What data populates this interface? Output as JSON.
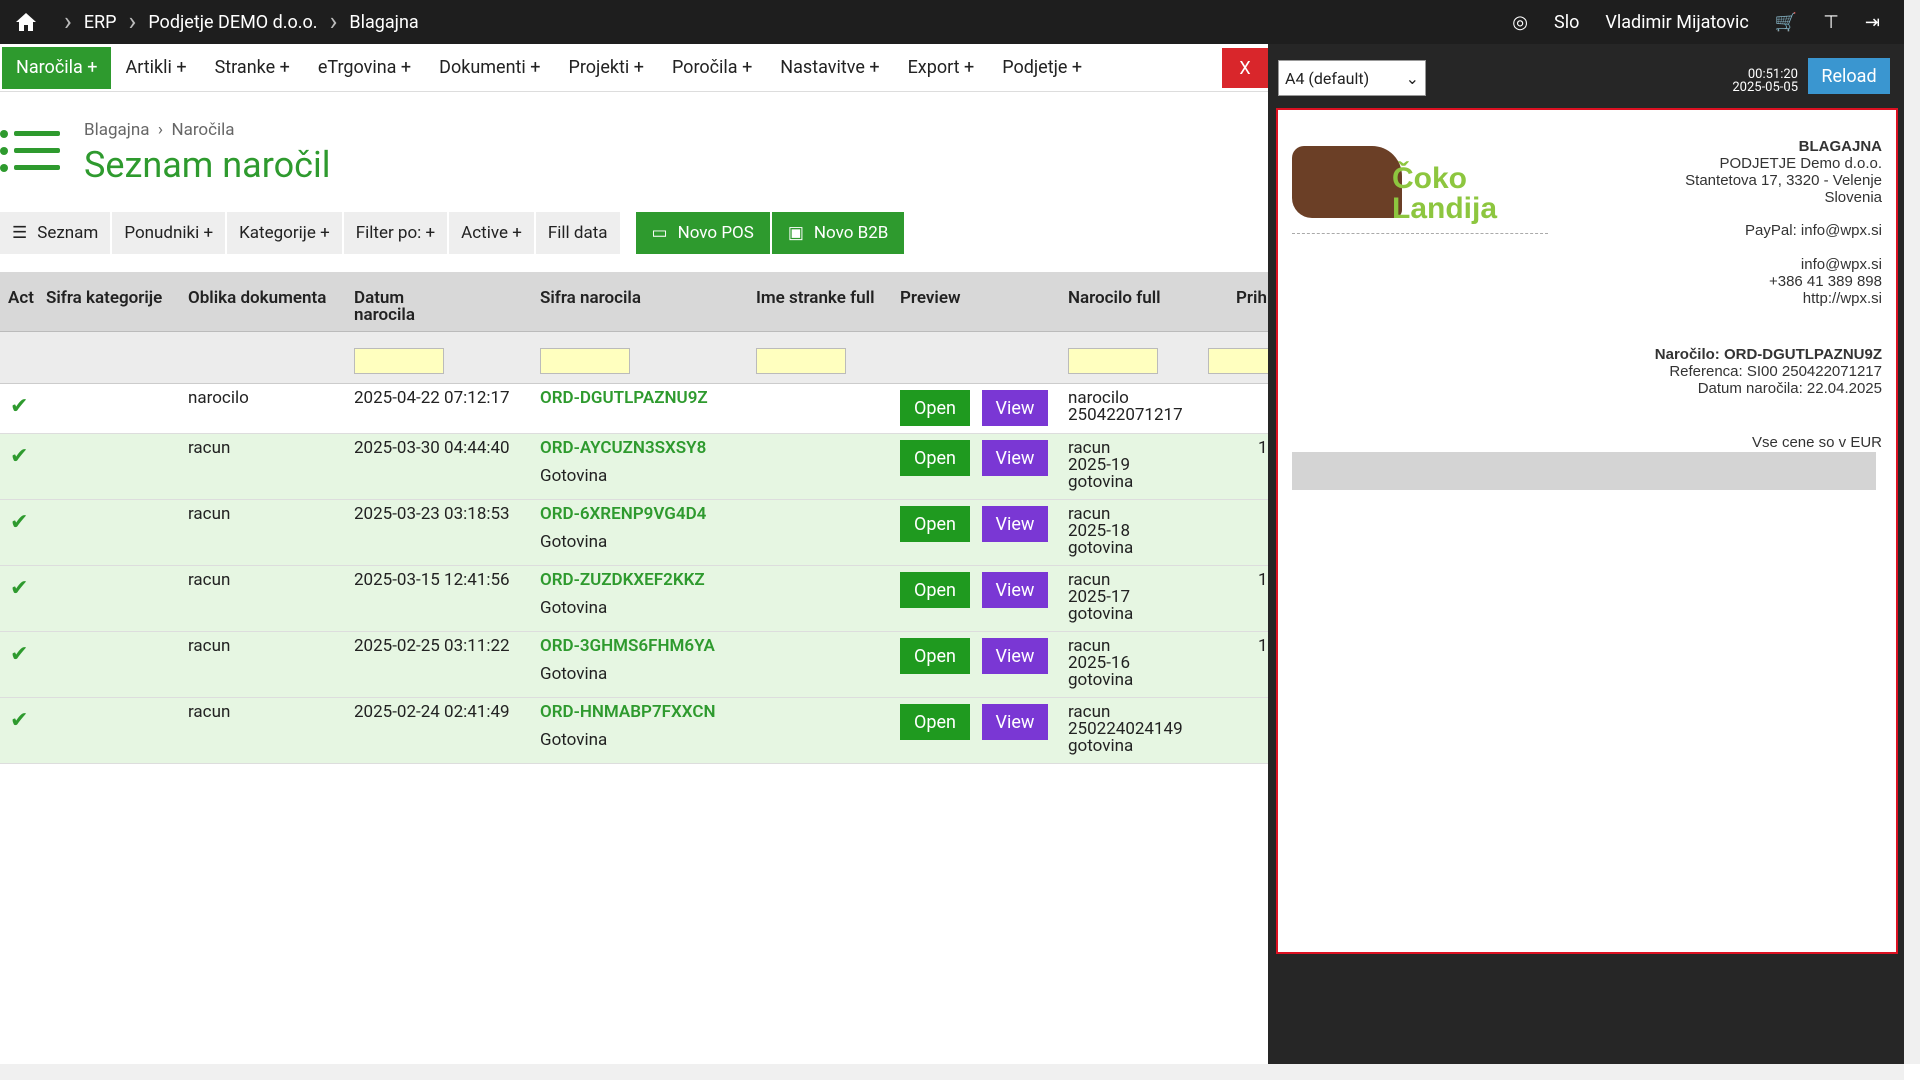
{
  "topbar": {
    "crumbs": [
      "ERP",
      "Podjetje DEMO d.o.o.",
      "Blagajna"
    ],
    "lang": "Slo",
    "user": "Vladimir Mijatovic"
  },
  "menu": [
    "Naročila +",
    "Artikli +",
    "Stranke +",
    "eTrgovina +",
    "Dokumenti +",
    "Projekti +",
    "Poročila +",
    "Nastavitve +",
    "Export +",
    "Podjetje +"
  ],
  "close_label": "X",
  "breadcrumb": {
    "a": "Blagajna",
    "b": "Naročila"
  },
  "page_title": "Seznam naročil",
  "toolbar": {
    "seznam": "Seznam",
    "ponudniki": "Ponudniki +",
    "kategorije": "Kategorije +",
    "filter": "Filter po: +",
    "active": "Active +",
    "fill": "Fill data",
    "novo_pos": "Novo POS",
    "novo_b2b": "Novo B2B"
  },
  "columns": {
    "act": "Act",
    "sifra_kat": "Sifra kategorije",
    "oblika": "Oblika dokumenta",
    "datum1": "Datum",
    "datum2": "narocila",
    "sifra_nar": "Sifra narocila",
    "ime": "Ime stranke full",
    "preview": "Preview",
    "narocilo_full": "Narocilo full",
    "prih": "Prih"
  },
  "buttons": {
    "open": "Open",
    "view": "View"
  },
  "rows": [
    {
      "oblika": "narocilo",
      "datum": "2025-04-22 07:12:17",
      "sifra": "ORD-DGUTLPAZNU9Z",
      "status": "",
      "full1": "narocilo",
      "full2": "250422071217",
      "full3": "",
      "prih": "",
      "green": false
    },
    {
      "oblika": "racun",
      "datum": "2025-03-30 04:44:40",
      "sifra": "ORD-AYCUZN3SXSY8",
      "status": "Gotovina",
      "full1": "racun",
      "full2": "2025-19",
      "full3": "gotovina",
      "prih": "1",
      "green": true
    },
    {
      "oblika": "racun",
      "datum": "2025-03-23 03:18:53",
      "sifra": "ORD-6XRENP9VG4D4",
      "status": "Gotovina",
      "full1": "racun",
      "full2": "2025-18",
      "full3": "gotovina",
      "prih": "",
      "green": true
    },
    {
      "oblika": "racun",
      "datum": "2025-03-15 12:41:56",
      "sifra": "ORD-ZUZDKXEF2KKZ",
      "status": "Gotovina",
      "full1": "racun",
      "full2": "2025-17",
      "full3": "gotovina",
      "prih": "1",
      "green": true
    },
    {
      "oblika": "racun",
      "datum": "2025-02-25 03:11:22",
      "sifra": "ORD-3GHMS6FHM6YA",
      "status": "Gotovina",
      "full1": "racun",
      "full2": "2025-16",
      "full3": "gotovina",
      "prih": "1",
      "green": true
    },
    {
      "oblika": "racun",
      "datum": "2025-02-24 02:41:49",
      "sifra": "ORD-HNMABP7FXXCN",
      "status": "Gotovina",
      "full1": "racun",
      "full2": "250224024149",
      "full3": "gotovina",
      "prih": "",
      "green": true
    }
  ],
  "panel": {
    "select": "A4 (default)",
    "time": "00:51:20",
    "date": "2025-05-05",
    "reload": "Reload"
  },
  "doc": {
    "h": "BLAGAJNA",
    "l1": "PODJETJE Demo d.o.o.",
    "l2": "Stantetova 17, 3320 - Velenje",
    "l3": "Slovenia",
    "paypal": "PayPal: info@wpx.si",
    "email": "info@wpx.si",
    "phone": "+386 41 389 898",
    "web": "http://wpx.si",
    "order": "Naročilo: ORD-DGUTLPAZNU9Z",
    "ref": "Referenca: SI00 250422071217",
    "date": "Datum naročila: 22.04.2025",
    "cur": "Vse cene so v EUR",
    "logo": "Čoko Landija"
  }
}
